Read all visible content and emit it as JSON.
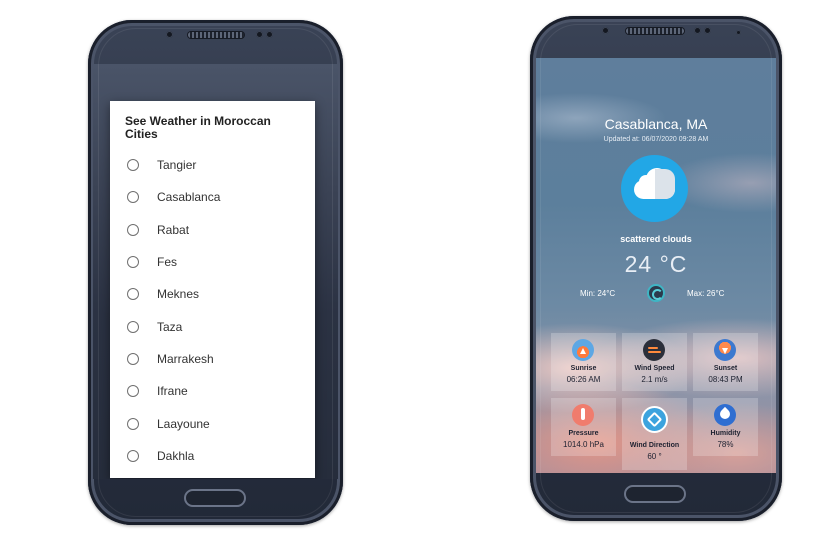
{
  "left_screen": {
    "dialog_title": "See Weather in Moroccan Cities",
    "cities": [
      "Tangier",
      "Casablanca",
      "Rabat",
      "Fes",
      "Meknes",
      "Taza",
      "Marrakesh",
      "Ifrane",
      "Laayoune",
      "Dakhla"
    ]
  },
  "right_screen": {
    "city": "Casablanca, MA",
    "updated": "Updated at: 06/07/2020 09:28 AM",
    "description": "scattered clouds",
    "temperature": "24 °C",
    "min": "Min: 24°C",
    "max": "Max: 26°C",
    "tiles": {
      "sunrise": {
        "label": "Sunrise",
        "value": "06:26 AM",
        "icon": "sunrise-icon"
      },
      "wind_speed": {
        "label": "Wind Speed",
        "value": "2.1 m/s",
        "icon": "wind-icon"
      },
      "sunset": {
        "label": "Sunset",
        "value": "08:43 PM",
        "icon": "sunset-icon"
      },
      "pressure": {
        "label": "Pressure",
        "value": "1014.0 hPa",
        "icon": "thermometer-icon"
      },
      "wind_direction": {
        "label": "Wind Direction",
        "value": "60 °",
        "icon": "compass-arrow-icon"
      },
      "humidity": {
        "label": "Humidity",
        "value": "78%",
        "icon": "water-drop-icon"
      }
    }
  },
  "colors": {
    "weather_icon_blue": "#22a7e6",
    "dialog_bg": "#ffffff",
    "phone_body": "#2a3142"
  }
}
